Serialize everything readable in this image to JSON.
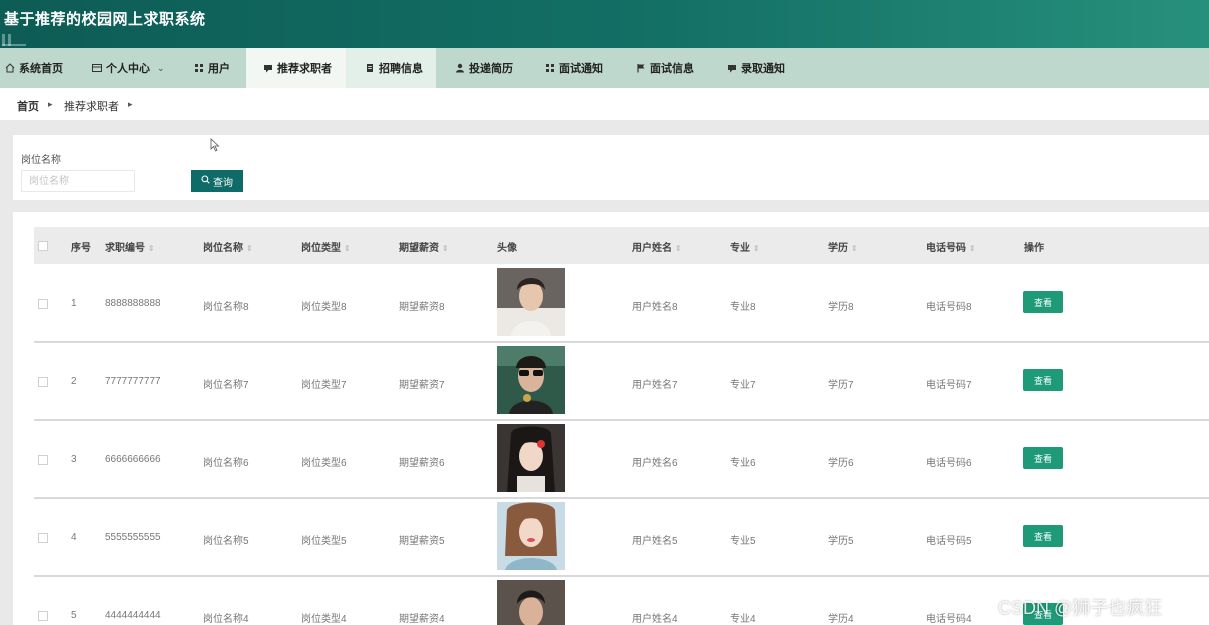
{
  "app": {
    "title": "基于推荐的校园网上求职系统"
  },
  "nav": {
    "items": [
      {
        "label": "系统首页",
        "icon": "home-icon"
      },
      {
        "label": "个人中心",
        "icon": "profile-icon",
        "has_dropdown": true
      },
      {
        "label": "用户",
        "icon": "grid-icon"
      },
      {
        "label": "推荐求职者",
        "icon": "comment-icon",
        "active": true
      },
      {
        "label": "招聘信息",
        "icon": "document-icon"
      },
      {
        "label": "投递简历",
        "icon": "user-icon"
      },
      {
        "label": "面试通知",
        "icon": "grid-icon"
      },
      {
        "label": "面试信息",
        "icon": "flag-icon"
      },
      {
        "label": "录取通知",
        "icon": "comment-icon"
      }
    ]
  },
  "breadcrumb": {
    "home": "首页",
    "current": "推荐求职者"
  },
  "search": {
    "label": "岗位名称",
    "placeholder": "岗位名称",
    "button": "查询"
  },
  "table": {
    "columns": [
      "序号",
      "求职编号",
      "岗位名称",
      "岗位类型",
      "期望薪资",
      "头像",
      "用户姓名",
      "专业",
      "学历",
      "电话号码",
      "操作"
    ],
    "rows": [
      {
        "index": "1",
        "job_no": "8888888888",
        "post_name": "岗位名称8",
        "post_type": "岗位类型8",
        "salary": "期望薪资8",
        "user_name": "用户姓名8",
        "major": "专业8",
        "education": "学历8",
        "phone": "电话号码8",
        "action": "查看"
      },
      {
        "index": "2",
        "job_no": "7777777777",
        "post_name": "岗位名称7",
        "post_type": "岗位类型7",
        "salary": "期望薪资7",
        "user_name": "用户姓名7",
        "major": "专业7",
        "education": "学历7",
        "phone": "电话号码7",
        "action": "查看"
      },
      {
        "index": "3",
        "job_no": "6666666666",
        "post_name": "岗位名称6",
        "post_type": "岗位类型6",
        "salary": "期望薪资6",
        "user_name": "用户姓名6",
        "major": "专业6",
        "education": "学历6",
        "phone": "电话号码6",
        "action": "查看"
      },
      {
        "index": "4",
        "job_no": "5555555555",
        "post_name": "岗位名称5",
        "post_type": "岗位类型5",
        "salary": "期望薪资5",
        "user_name": "用户姓名5",
        "major": "专业5",
        "education": "学历5",
        "phone": "电话号码5",
        "action": "查看"
      },
      {
        "index": "5",
        "job_no": "4444444444",
        "post_name": "岗位名称4",
        "post_type": "岗位类型4",
        "salary": "期望薪资4",
        "user_name": "用户姓名4",
        "major": "专业4",
        "education": "学历4",
        "phone": "电话号码4",
        "action": "查看"
      }
    ]
  },
  "watermark": "CSDN @狮子也疯狂",
  "colors": {
    "header": "#137065",
    "nav_bg": "#bfd8cd",
    "search_button": "#0f6b68",
    "view_button": "#1e9a78"
  }
}
